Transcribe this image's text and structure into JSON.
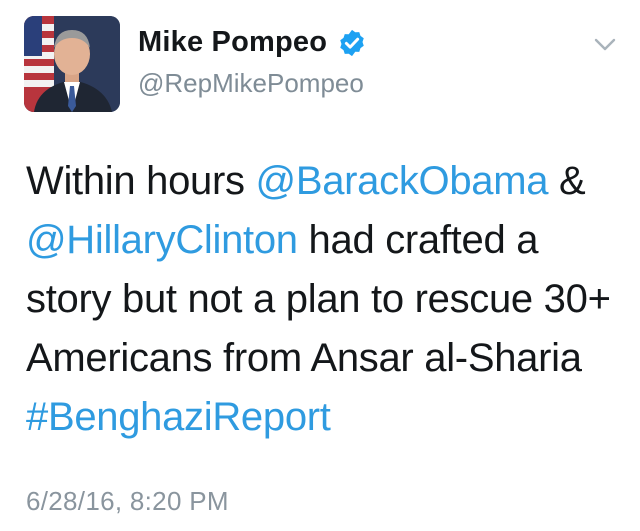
{
  "user": {
    "display_name": "Mike Pompeo",
    "handle": "@RepMikePompeo",
    "verified_icon": "verified-badge-icon",
    "options_icon": "chevron-down-icon"
  },
  "tweet": {
    "segments": [
      {
        "text": "Within hours ",
        "type": "text"
      },
      {
        "text": "@BarackObama",
        "type": "mention"
      },
      {
        "text": " & ",
        "type": "text"
      },
      {
        "text": "@HillaryClinton",
        "type": "mention"
      },
      {
        "text": " had crafted a story but not a plan to rescue 30+ Americans from Ansar al-Sharia ",
        "type": "text"
      },
      {
        "text": "#BenghaziReport",
        "type": "hashtag"
      }
    ],
    "timestamp": "6/28/16, 8:20 PM"
  },
  "colors": {
    "link": "#2f9be0",
    "text": "#14171a",
    "secondary": "#7f8c96",
    "verified": "#1da1f2"
  }
}
